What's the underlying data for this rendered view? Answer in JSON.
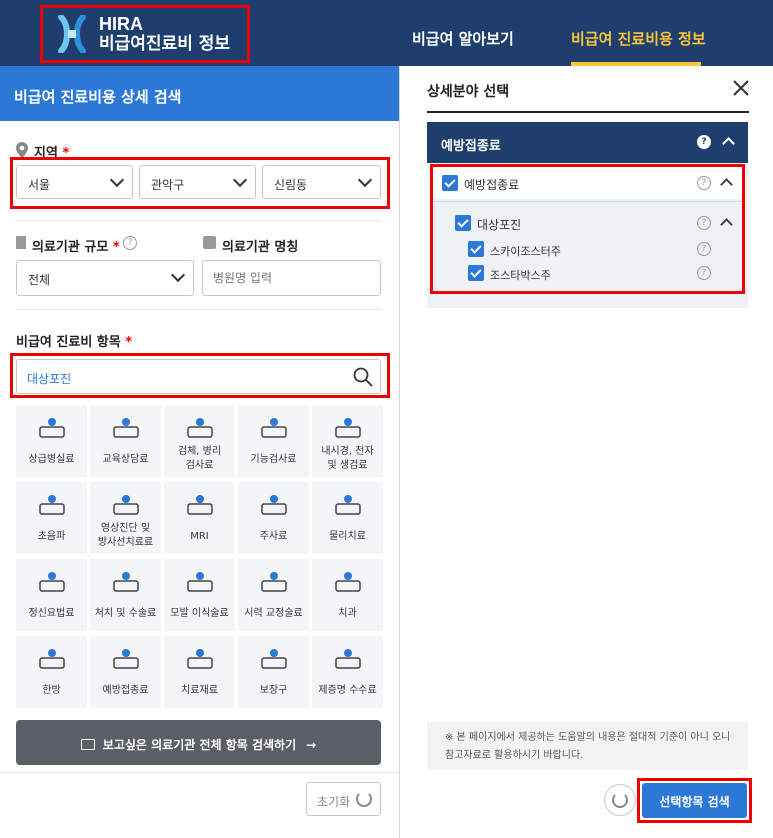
{
  "header": {
    "logo_line1": "HIRA",
    "logo_line2": "비급여진료비 정보",
    "nav": [
      {
        "label": "비급여 알아보기"
      },
      {
        "label": "비급여 진료비용 정보"
      }
    ]
  },
  "left": {
    "title": "비급여 진료비용 상세 검색",
    "region_label": "지역",
    "required_mark": "*",
    "region_selects": [
      "서울",
      "관악구",
      "신림동"
    ],
    "scale_label": "의료기관 규모",
    "scale_value": "전체",
    "name_label": "의료기관 명칭",
    "name_placeholder": "병원명 입력",
    "item_label": "비급여 진료비 항목",
    "item_search_value": "대상포진",
    "categories": [
      {
        "line1": "상급병실료",
        "line2": ""
      },
      {
        "line1": "교육상담료",
        "line2": ""
      },
      {
        "line1": "검체, 병리",
        "line2": "검사료"
      },
      {
        "line1": "기능검사료",
        "line2": ""
      },
      {
        "line1": "내시경, 천자",
        "line2": "및 생검료"
      },
      {
        "line1": "초음파",
        "line2": ""
      },
      {
        "line1": "영상진단 및",
        "line2": "방사선치료료"
      },
      {
        "line1": "MRI",
        "line2": ""
      },
      {
        "line1": "주사료",
        "line2": ""
      },
      {
        "line1": "물리치료",
        "line2": ""
      },
      {
        "line1": "정신요법료",
        "line2": ""
      },
      {
        "line1": "처치 및 수술료",
        "line2": ""
      },
      {
        "line1": "모발 이식술료",
        "line2": ""
      },
      {
        "line1": "시력 교정술료",
        "line2": ""
      },
      {
        "line1": "치과",
        "line2": ""
      },
      {
        "line1": "한방",
        "line2": ""
      },
      {
        "line1": "예방접종료",
        "line2": ""
      },
      {
        "line1": "치료재료",
        "line2": ""
      },
      {
        "line1": "보장구",
        "line2": ""
      },
      {
        "line1": "제증명 수수료",
        "line2": ""
      }
    ],
    "full_search_button": "보고싶은 의료기관 전체 항목 검색하기",
    "reset_button": "초기화"
  },
  "right": {
    "title": "상세분야 선택",
    "section_title": "예방접종료",
    "tree": [
      {
        "label": "예방접종료",
        "level": 0
      },
      {
        "label": "대상포진",
        "level": 1
      },
      {
        "label": "스카이조스터주",
        "level": 2
      },
      {
        "label": "조스타박스주",
        "level": 2
      }
    ],
    "notice": "※ 본 페이지에서 제공하는 도움말의 내용은 절대적 기준이 아니 오니참고자료로 활용하시기 바랍니다.",
    "search_button": "선택항목 검색"
  },
  "colors": {
    "header_bg": "#1e3f6e",
    "accent_blue": "#2b78d6",
    "accent_yellow": "#f7c43a",
    "highlight_red": "#e00000"
  }
}
